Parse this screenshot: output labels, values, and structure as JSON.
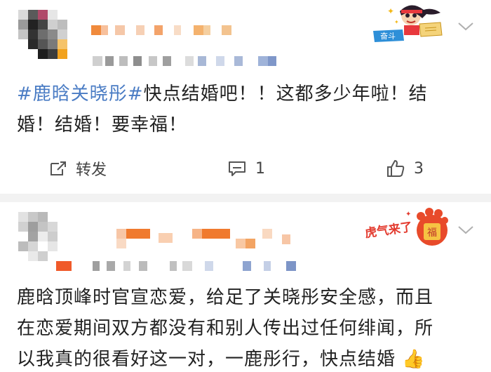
{
  "post1": {
    "hashtag": "#鹿晗关晓彤#",
    "text_line1": "快点结婚吧！！这都多少年啦！结",
    "text_line2": "婚！结婚！要幸福！",
    "actions": {
      "repost_label": "转发",
      "comment_count": "1",
      "like_count": "3"
    },
    "decoration": {
      "badge_text": "奋斗",
      "icon": "girl-with-book-sticker"
    }
  },
  "post2": {
    "text_line1": "鹿晗顶峰时官宣恋爱，给足了关晓彤安全感，而且",
    "text_line2": "在恋爱期间双方都没有和别人传出过任何绯闻，所",
    "text_line3": "以我真的很看好这一对，一鹿彤行，快点结婚",
    "emoji": "👍",
    "decoration": {
      "sticker_text": "虎气来了",
      "icon": "tiger-paw-sticker"
    }
  },
  "colors": {
    "hashtag": "#4a7cc4",
    "text": "#222222",
    "muted": "#444444"
  }
}
